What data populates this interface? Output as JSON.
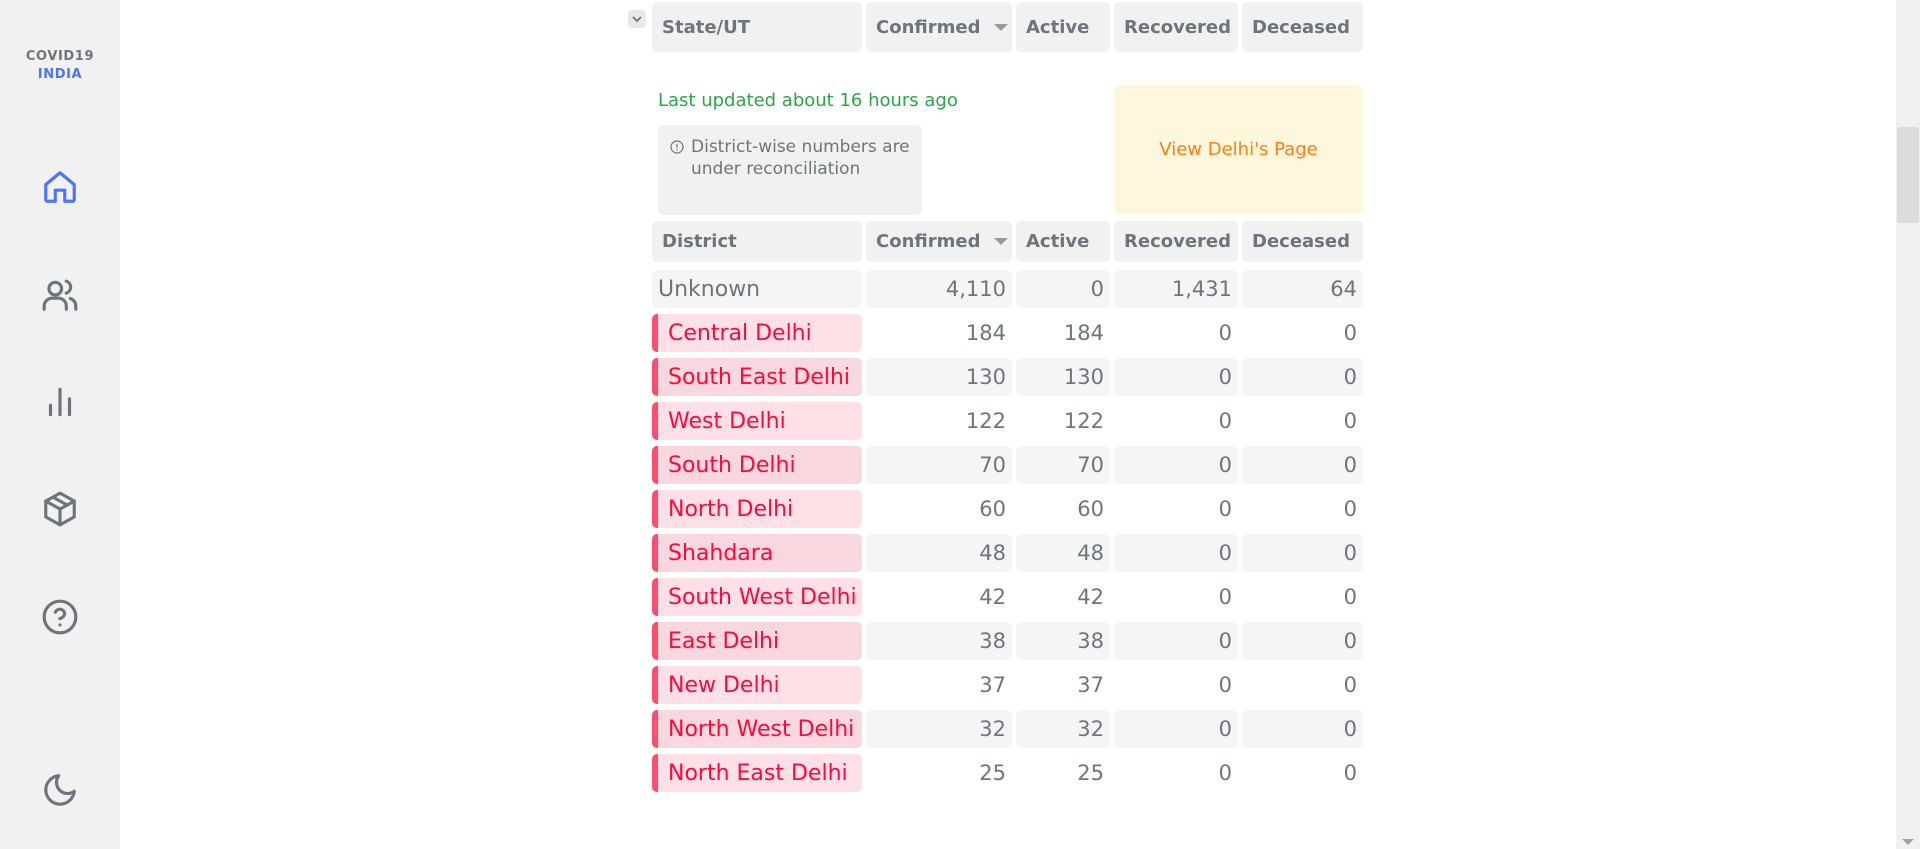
{
  "brand": {
    "line1": "COVID19",
    "line2": "INDIA"
  },
  "nav": [
    {
      "name": "home-icon",
      "active": true
    },
    {
      "name": "users-icon",
      "active": false
    },
    {
      "name": "bar-chart-icon",
      "active": false
    },
    {
      "name": "box-icon",
      "active": false
    },
    {
      "name": "help-icon",
      "active": false
    },
    {
      "name": "moon-icon",
      "active": false
    }
  ],
  "state_header": {
    "state_label": "State/UT",
    "confirmed": "Confirmed",
    "active": "Active",
    "recovered": "Recovered",
    "deceased": "Deceased"
  },
  "last_updated": "Last updated about 16 hours ago",
  "notice": "District-wise numbers are under reconciliation",
  "view_page_label": "View Delhi's Page",
  "district_header": {
    "district": "District",
    "confirmed": "Confirmed",
    "active": "Active",
    "recovered": "Recovered",
    "deceased": "Deceased"
  },
  "unknown_row": {
    "name": "Unknown",
    "confirmed": "4,110",
    "active": "0",
    "recovered": "1,431",
    "deceased": "64"
  },
  "districts": [
    {
      "name": "Central Delhi",
      "confirmed": "184",
      "active": "184",
      "recovered": "0",
      "deceased": "0"
    },
    {
      "name": "South East Delhi",
      "confirmed": "130",
      "active": "130",
      "recovered": "0",
      "deceased": "0"
    },
    {
      "name": "West Delhi",
      "confirmed": "122",
      "active": "122",
      "recovered": "0",
      "deceased": "0"
    },
    {
      "name": "South Delhi",
      "confirmed": "70",
      "active": "70",
      "recovered": "0",
      "deceased": "0"
    },
    {
      "name": "North Delhi",
      "confirmed": "60",
      "active": "60",
      "recovered": "0",
      "deceased": "0"
    },
    {
      "name": "Shahdara",
      "confirmed": "48",
      "active": "48",
      "recovered": "0",
      "deceased": "0"
    },
    {
      "name": "South West Delhi",
      "confirmed": "42",
      "active": "42",
      "recovered": "0",
      "deceased": "0"
    },
    {
      "name": "East Delhi",
      "confirmed": "38",
      "active": "38",
      "recovered": "0",
      "deceased": "0"
    },
    {
      "name": "New Delhi",
      "confirmed": "37",
      "active": "37",
      "recovered": "0",
      "deceased": "0"
    },
    {
      "name": "North West Delhi",
      "confirmed": "32",
      "active": "32",
      "recovered": "0",
      "deceased": "0"
    },
    {
      "name": "North East Delhi",
      "confirmed": "25",
      "active": "25",
      "recovered": "0",
      "deceased": "0"
    }
  ],
  "colors": {
    "accent_blue": "#4c75f2",
    "confirmed_red": "#ff073a",
    "updated_green": "#28a745",
    "view_orange": "#fd7e14"
  }
}
